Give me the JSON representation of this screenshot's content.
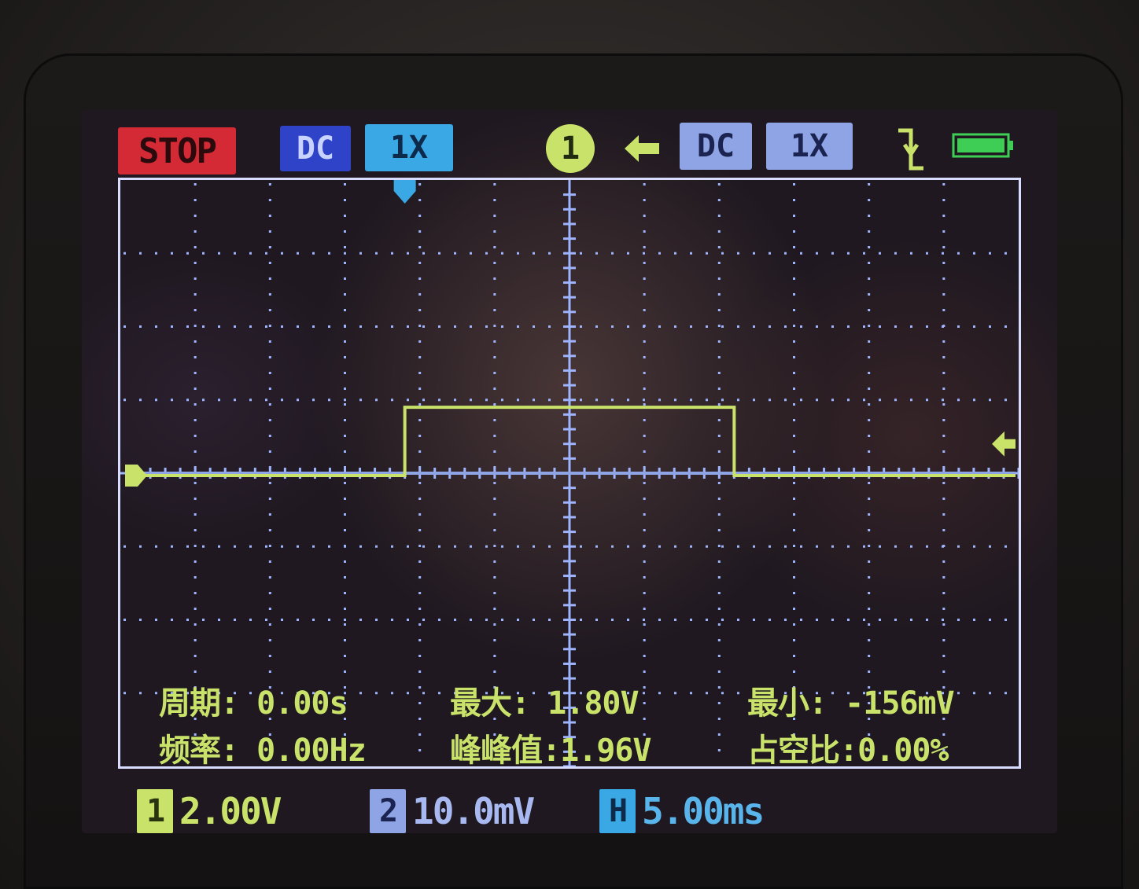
{
  "status": {
    "run_state": "STOP",
    "color": "#d42a35"
  },
  "channel1": {
    "coupling": "DC",
    "probe": "1X",
    "scale_tag": "1",
    "volts_per_div": "2.00V",
    "color": "#c9e26a"
  },
  "channel2": {
    "coupling": "DC",
    "probe": "1X",
    "scale_tag": "2",
    "volts_per_div": "10.0mV",
    "color": "#8fa4e4"
  },
  "active_channel": "1",
  "timebase": {
    "tag": "H",
    "time_per_div": "5.00ms",
    "color": "#39a8e4"
  },
  "icons": {
    "arrow": "arrow-left-icon",
    "trigger": "trigger-falling-edge-icon",
    "battery": "battery-full-icon"
  },
  "measurements": {
    "period": "周期: 0.00s",
    "frequency": "频率: 0.00Hz",
    "max": "最大: 1.80V",
    "peak_to_peak": "峰峰值:1.96V",
    "min": "最小: -156mV",
    "duty_cycle": "占空比:0.00%"
  },
  "waveform": {
    "divisions": {
      "horizontal": 12,
      "vertical": 8
    },
    "channel1_trace": {
      "baseline_div": 0,
      "high_div": 0.9,
      "rise_at_div": -2.2,
      "fall_at_div": 2.2
    },
    "channel2_trace": {
      "level_div": 0
    },
    "trigger_level_div": 0.4,
    "grid_color": "#9fb4ff"
  }
}
